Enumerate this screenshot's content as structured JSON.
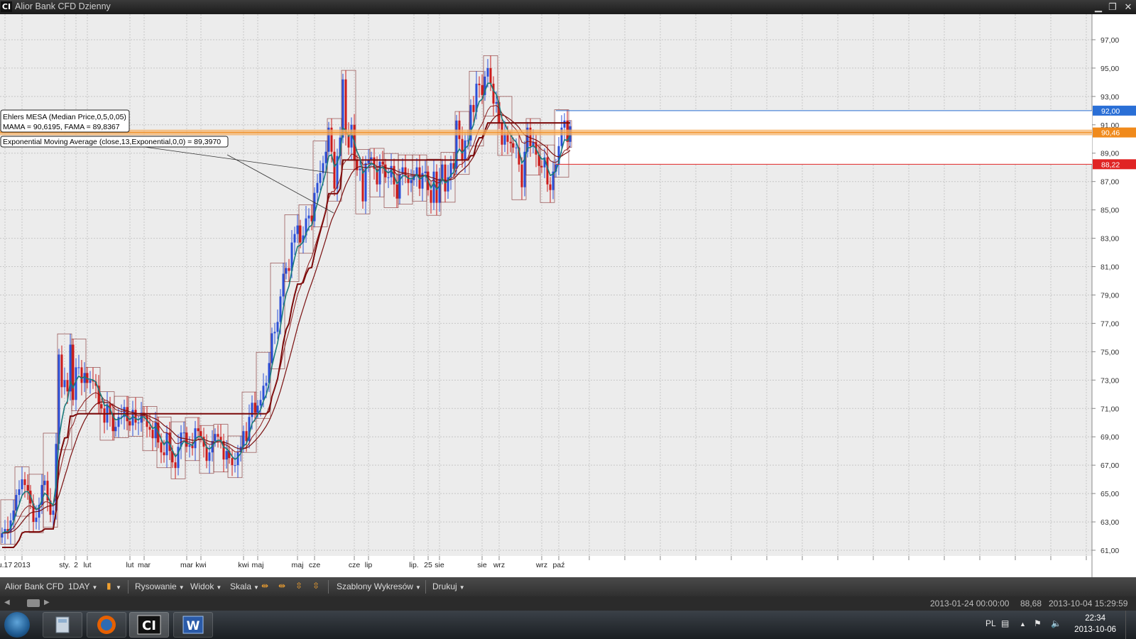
{
  "window": {
    "logo": "CI",
    "title": "Alior Bank CFD Dzienny",
    "minimize": "▁",
    "restore": "❐",
    "close": "✕"
  },
  "chart_data": {
    "type": "candlestick",
    "ylim": [
      60.6,
      98.8
    ],
    "y_ticks": [
      "97,00",
      "95,00",
      "93,00",
      "91,00",
      "89,00",
      "87,00",
      "85,00",
      "83,00",
      "81,00",
      "79,00",
      "77,00",
      "75,00",
      "73,00",
      "71,00",
      "69,00",
      "67,00",
      "65,00",
      "63,00",
      "61,00"
    ],
    "x_tick_labels": [
      {
        "label": "u.17",
        "bar": 1
      },
      {
        "label": "2013",
        "bar": 7
      },
      {
        "label": "sty.",
        "bar": 22
      },
      {
        "label": "2",
        "bar": 26
      },
      {
        "label": "lut",
        "bar": 30
      },
      {
        "label": "lut",
        "bar": 45
      },
      {
        "label": "mar",
        "bar": 50
      },
      {
        "label": "mar",
        "bar": 65
      },
      {
        "label": "kwi",
        "bar": 70
      },
      {
        "label": "kwi",
        "bar": 85
      },
      {
        "label": "maj",
        "bar": 90
      },
      {
        "label": "maj",
        "bar": 104
      },
      {
        "label": "cze",
        "bar": 110
      },
      {
        "label": "cze",
        "bar": 124
      },
      {
        "label": "lip",
        "bar": 129
      },
      {
        "label": "lip.",
        "bar": 145
      },
      {
        "label": "25",
        "bar": 150
      },
      {
        "label": "sie",
        "bar": 154
      },
      {
        "label": "sie",
        "bar": 169
      },
      {
        "label": "wrz",
        "bar": 175
      },
      {
        "label": "wrz",
        "bar": 190
      },
      {
        "label": "paź",
        "bar": 196
      }
    ],
    "closes": [
      62.2,
      62.5,
      62.3,
      63.1,
      63.8,
      64.9,
      65.3,
      66.0,
      65.6,
      65.2,
      64.3,
      63.0,
      63.3,
      64.2,
      65.6,
      65.9,
      64.5,
      63.5,
      63.8,
      68.5,
      74.8,
      72.5,
      73.0,
      72.2,
      75.5,
      71.6,
      73.9,
      73.9,
      72.8,
      73.5,
      72.8,
      73.0,
      72.9,
      72.6,
      71.3,
      71.0,
      70.0,
      71.3,
      70.6,
      69.4,
      69.7,
      70.4,
      70.4,
      71.1,
      70.1,
      69.8,
      70.9,
      70.0,
      70.0,
      70.7,
      70.5,
      69.7,
      69.5,
      68.9,
      70.0,
      68.6,
      67.9,
      67.7,
      69.3,
      68.0,
      67.2,
      66.8,
      68.3,
      69.3,
      69.3,
      68.3,
      68.4,
      68.2,
      69.6,
      69.4,
      69.0,
      68.3,
      67.3,
      67.9,
      68.7,
      69.2,
      69.0,
      68.7,
      67.4,
      68.0,
      67.5,
      67.0,
      67.0,
      67.9,
      68.3,
      69.4,
      68.7,
      70.4,
      71.4,
      70.7,
      71.2,
      71.6,
      72.6,
      72.8,
      74.2,
      76.3,
      76.4,
      77.1,
      78.9,
      80.5,
      80.9,
      80.7,
      82.7,
      83.3,
      83.9,
      82.7,
      83.2,
      84.4,
      84.6,
      84.2,
      86.2,
      86.9,
      87.6,
      88.3,
      89.1,
      90.8,
      89.1,
      86.5,
      88.8,
      90.1,
      94.2,
      90.3,
      89.4,
      91.0,
      88.5,
      87.8,
      87.9,
      85.6,
      88.3,
      88.5,
      88.7,
      87.9,
      86.8,
      88.4,
      88.2,
      87.3,
      87.3,
      88.1,
      86.8,
      85.8,
      87.5,
      88.0,
      87.4,
      86.9,
      87.1,
      87.4,
      88.0,
      86.5,
      87.6,
      87.7,
      86.4,
      85.5,
      87.7,
      85.5,
      87.2,
      88.2,
      86.3,
      87.3,
      88.3,
      87.9,
      91.3,
      90.0,
      88.5,
      89.9,
      89.9,
      92.4,
      91.9,
      93.9,
      93.8,
      93.1,
      94.4,
      95.0,
      93.9,
      92.5,
      92.6,
      91.1,
      89.6,
      90.4,
      89.8,
      89.7,
      89.4,
      89.4,
      88.2,
      86.6,
      89.1,
      90.8,
      89.5,
      89.8,
      88.9,
      88.1,
      88.0,
      88.7,
      86.8,
      86.4,
      87.7,
      88.2,
      89.5,
      90.8,
      91.3,
      89.8,
      90.9
    ],
    "series": [
      {
        "name": "MAMA",
        "value": 90.6195,
        "color": "#1a7a7a"
      },
      {
        "name": "FAMA",
        "value": 89.8367,
        "color": "#7a1010"
      },
      {
        "name": "EMA 13",
        "value": 89.397,
        "color": "#8a1a1a"
      }
    ],
    "annotations": [
      {
        "line1": "Ehlers MESA (Median Price,0,5,0,05)",
        "line2": "MAMA = 90,6195, FAMA = 89,8367"
      },
      {
        "line1": "Exponential Moving Average (close,13,Exponential,0,0) = 89,3970"
      }
    ],
    "price_lines": [
      {
        "label": "92,00",
        "value": 92.0,
        "color": "#2a6fd6"
      },
      {
        "label": "90,46",
        "value": 90.46,
        "color": "#f08a1c"
      },
      {
        "label": "88,22",
        "value": 88.22,
        "color": "#e02424"
      }
    ]
  },
  "toolbar": {
    "symbol": "Alior Bank CFD",
    "interval": "1DAY",
    "drawing": "Rysowanie",
    "view": "Widok",
    "scale": "Skala",
    "templates": "Szablony Wykresów",
    "print": "Drukuj"
  },
  "status": {
    "start": "2013-01-24 00:00:00",
    "price": "88,68",
    "end": "2013-10-04 15:29:59"
  },
  "taskbar": {
    "lang": "PL",
    "time": "22:34",
    "date": "2013-10-06",
    "apps": [
      {
        "name": "calculator-icon",
        "label": ""
      },
      {
        "name": "firefox-icon",
        "label": ""
      },
      {
        "name": "ci-app-icon",
        "label": "CI"
      },
      {
        "name": "word-icon",
        "label": "W"
      }
    ]
  }
}
